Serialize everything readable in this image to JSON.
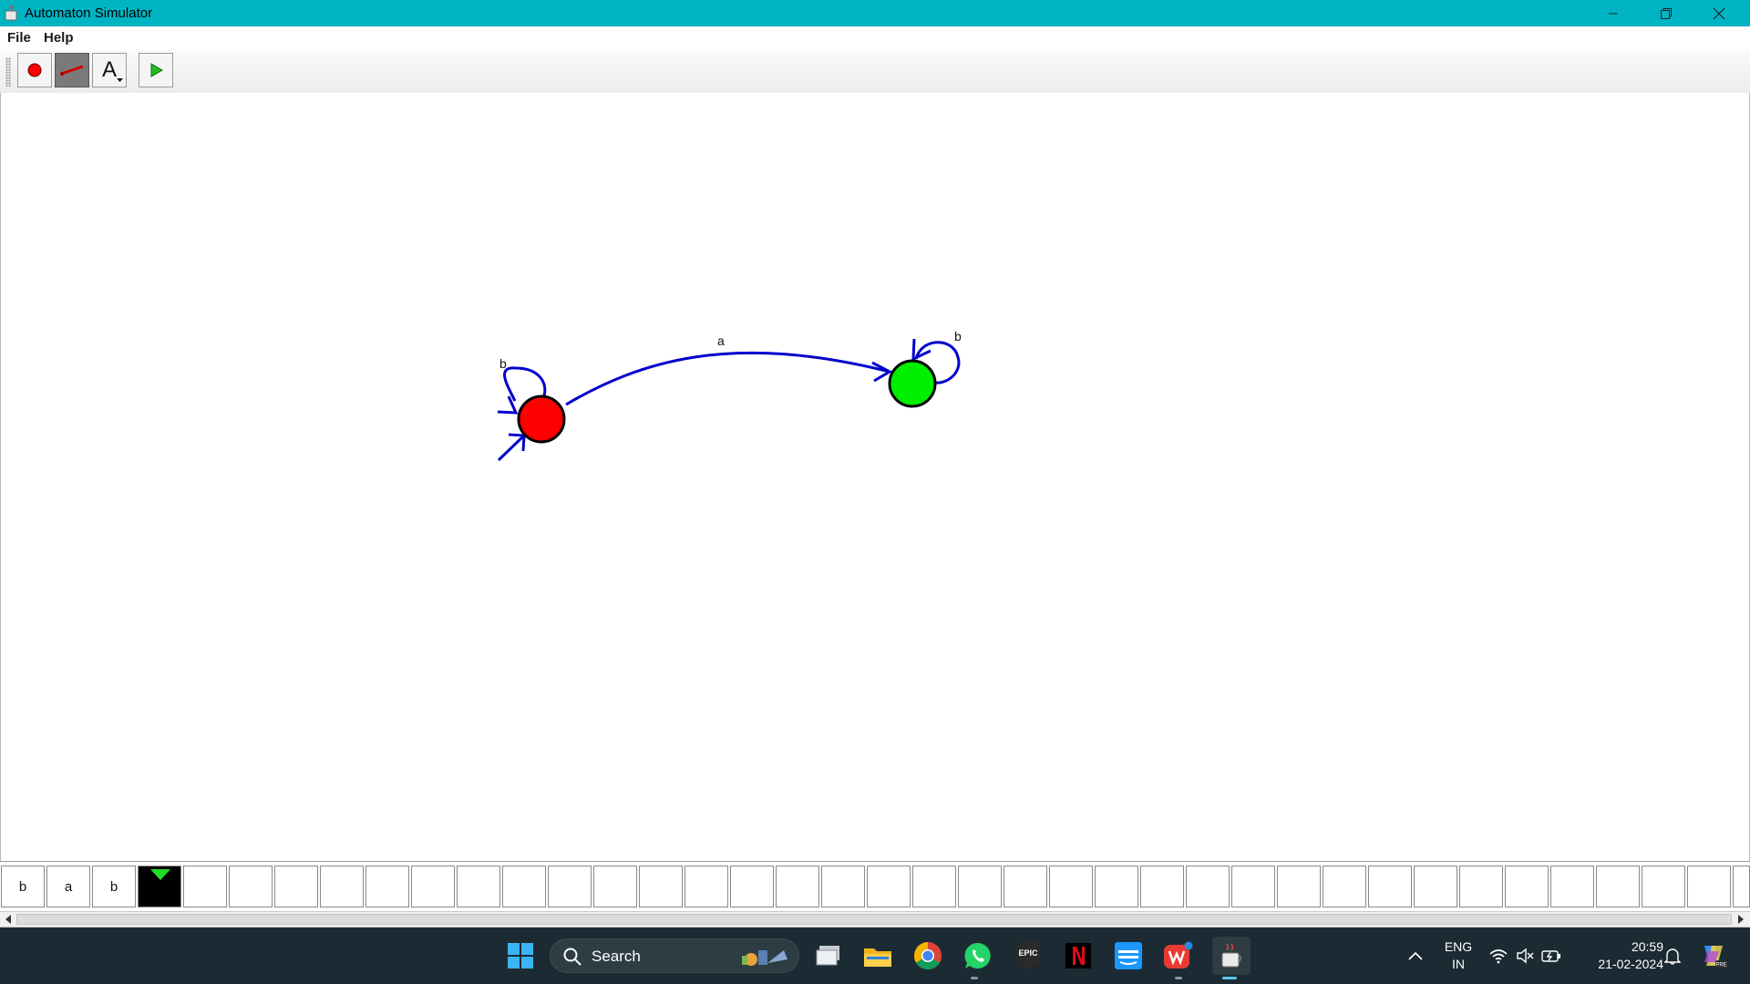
{
  "window": {
    "title": "Automaton Simulator",
    "icons": {
      "app": "java-cup-icon",
      "minimize": "minimize-icon",
      "maximize": "restore-icon",
      "close": "close-icon"
    }
  },
  "menu": {
    "items": [
      "File",
      "Help"
    ]
  },
  "toolbar": {
    "tools": [
      {
        "name": "add-state-tool",
        "icon": "red-dot-icon",
        "selected": false
      },
      {
        "name": "add-transition-tool",
        "icon": "line-icon",
        "selected": true
      },
      {
        "name": "text-tool",
        "icon": "letter-a-icon",
        "label": "A",
        "selected": false
      },
      {
        "name": "run-tool",
        "icon": "play-icon",
        "selected": false
      }
    ]
  },
  "automaton": {
    "states": [
      {
        "id": "q0",
        "color": "#ff0000",
        "initial": true
      },
      {
        "id": "q1",
        "color": "#00ee00",
        "initial": false
      }
    ],
    "transitions": [
      {
        "from": "q0",
        "to": "q0",
        "symbol": "b"
      },
      {
        "from": "q0",
        "to": "q1",
        "symbol": "a"
      },
      {
        "from": "q1",
        "to": "q1",
        "symbol": "b"
      }
    ],
    "edge_color": "#0000cc"
  },
  "tape": {
    "cells": [
      "b",
      "a",
      "b",
      "",
      "",
      "",
      "",
      "",
      "",
      "",
      "",
      "",
      "",
      "",
      "",
      "",
      "",
      "",
      "",
      "",
      "",
      "",
      "",
      "",
      "",
      "",
      "",
      "",
      "",
      "",
      "",
      "",
      "",
      "",
      "",
      "",
      "",
      "",
      "",
      ""
    ],
    "head_index": 3,
    "head_color": "#22dd22"
  },
  "taskbar": {
    "search_label": "Search",
    "apps": [
      "windows-start-icon",
      "task-view-icon",
      "file-explorer-icon",
      "chrome-icon",
      "whatsapp-icon",
      "epic-games-icon",
      "netflix-icon",
      "prime-video-icon",
      "wps-office-icon",
      "java-icon"
    ],
    "tray": {
      "lang_top": "ENG",
      "lang_bottom": "IN",
      "time": "20:59",
      "date": "21-02-2024"
    }
  }
}
